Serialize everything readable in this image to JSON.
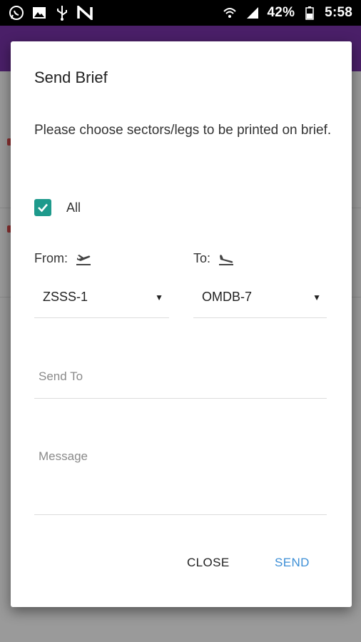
{
  "status_bar": {
    "left_icons": [
      "whatsapp-icon",
      "image-icon",
      "usb-icon",
      "n-app-icon"
    ],
    "battery_percent": "42%",
    "time": "5:58"
  },
  "dialog": {
    "title": "Send Brief",
    "message": "Please choose sectors/legs to be printed on brief.",
    "all_checkbox": {
      "label": "All",
      "checked": true
    },
    "from": {
      "label": "From:",
      "value": "ZSSS-1"
    },
    "to": {
      "label": "To:",
      "value": "OMDB-7"
    },
    "send_to": {
      "placeholder": "Send To",
      "value": ""
    },
    "message_field": {
      "placeholder": "Message",
      "value": ""
    },
    "actions": {
      "close": "CLOSE",
      "send": "SEND"
    }
  },
  "colors": {
    "accent": "#1e9a8c",
    "send_button": "#3d8fd6",
    "toolbar": "#4a1f68"
  }
}
